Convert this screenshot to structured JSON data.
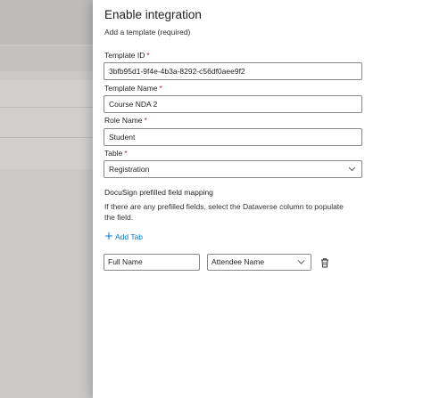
{
  "panel": {
    "title": "Enable integration",
    "subtitle": "Add a template (required)"
  },
  "form": {
    "template_id_label": "Template ID",
    "template_id_value": "3bfb95d1-9f4e-4b3a-8292-c56df0aee9f2",
    "template_name_label": "Template Name",
    "template_name_value": "Course NDA 2",
    "role_name_label": "Role Name",
    "role_name_value": "Student",
    "table_label": "Table",
    "table_value": "Registration",
    "required_marker": "*"
  },
  "mapping": {
    "title": "DocuSign prefilled field mapping",
    "description": "If there are any prefilled fields, select the Dataverse column to populate the field.",
    "add_tab_label": "Add Tab",
    "rows": [
      {
        "field_name": "Full Name",
        "column": "Attendee Name"
      }
    ]
  },
  "icons": {
    "add": "plus-icon",
    "dropdown": "chevron-down-icon",
    "delete": "trash-icon"
  },
  "colors": {
    "accent": "#0078d4",
    "required": "#a4262c"
  }
}
